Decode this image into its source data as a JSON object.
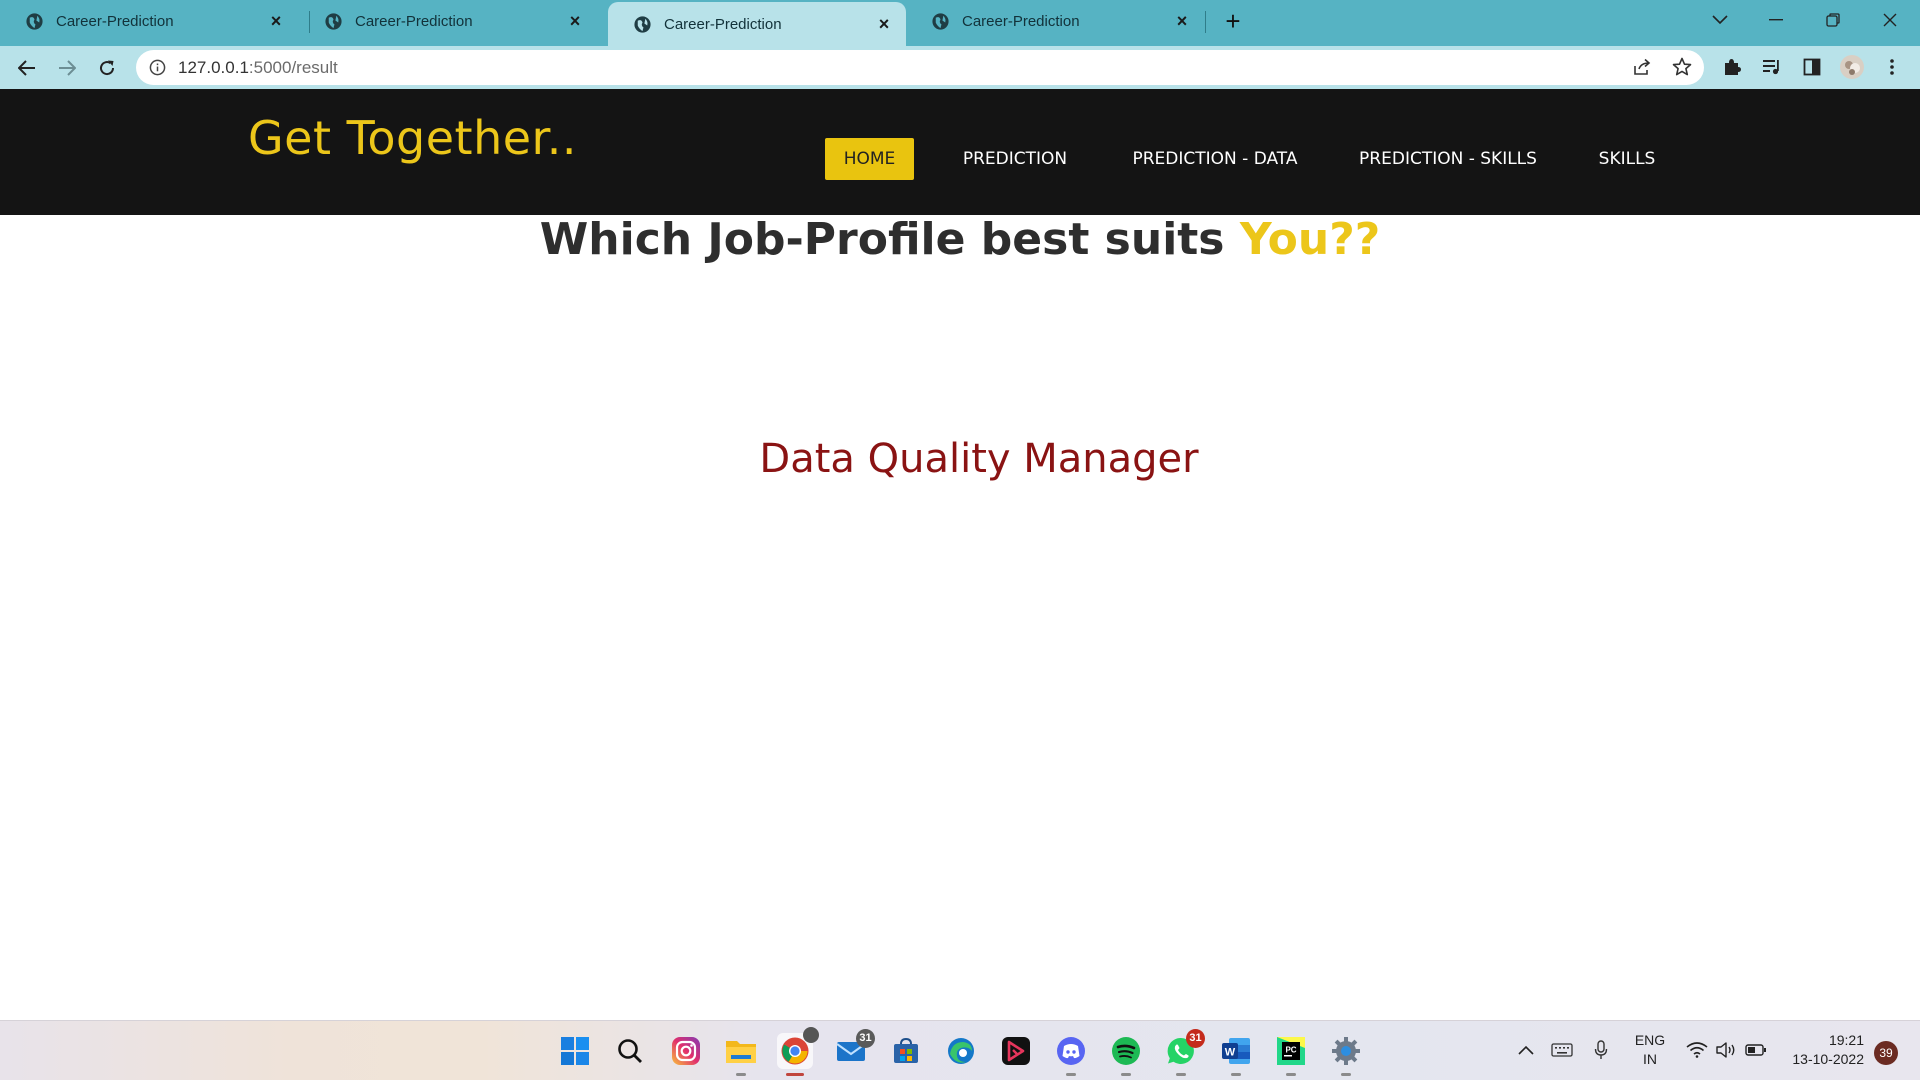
{
  "browser": {
    "tabs": [
      {
        "title": "Career-Prediction",
        "active": false
      },
      {
        "title": "Career-Prediction",
        "active": false
      },
      {
        "title": "Career-Prediction",
        "active": true
      },
      {
        "title": "Career-Prediction",
        "active": false
      }
    ],
    "url_host": "127.0.0.1",
    "url_path": ":5000/result"
  },
  "site": {
    "logo": "Get Together..",
    "nav": {
      "home": "HOME",
      "prediction": "PREDICTION",
      "prediction_data": "PREDICTION - DATA",
      "prediction_skills": "PREDICTION - SKILLS",
      "skills": "SKILLS"
    },
    "headline_main": "Which Job-Profile best suits ",
    "headline_accent": "You??",
    "result": "Data Quality Manager",
    "colors": {
      "accent": "#ecc61a",
      "header_bg": "#141414",
      "result": "#8a1313"
    }
  },
  "taskbar": {
    "mail_badge": "31",
    "whatsapp_badge": "31",
    "lang_line1": "ENG",
    "lang_line2": "IN",
    "time": "19:21",
    "date": "13-10-2022",
    "notifications": "39"
  }
}
